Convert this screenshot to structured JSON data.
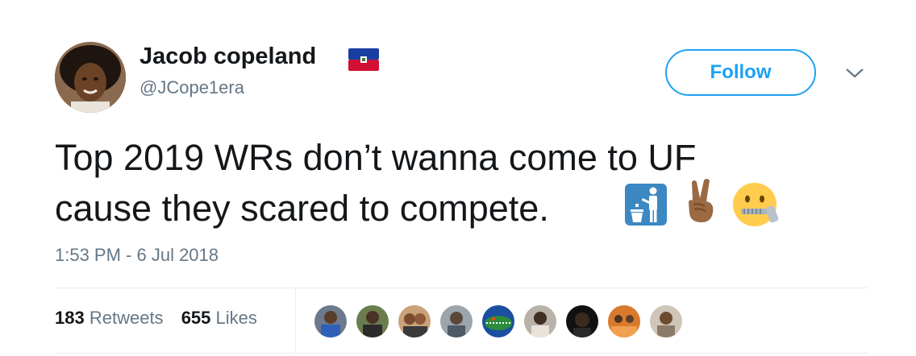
{
  "user": {
    "display_name": "Jacob copeland",
    "handle": "@JCope1era",
    "badge_icon": "haiti-flag-icon"
  },
  "actions": {
    "follow_label": "Follow",
    "menu_icon": "chevron-down-icon"
  },
  "tweet": {
    "line1": "Top 2019 WRs don’t wanna come to UF",
    "line2": "cause they scared to compete.",
    "emojis": [
      "litter-in-bin-icon",
      "victory-hand-icon",
      "zipper-mouth-face-icon"
    ],
    "timestamp": "1:53 PM - 6 Jul 2018"
  },
  "stats": {
    "retweets_count": "183",
    "retweets_label": "Retweets",
    "likes_count": "655",
    "likes_label": "Likes"
  },
  "colors": {
    "accent": "#1da1f2",
    "text": "#14171a",
    "muted": "#657786",
    "divider": "#e6ecf0"
  }
}
